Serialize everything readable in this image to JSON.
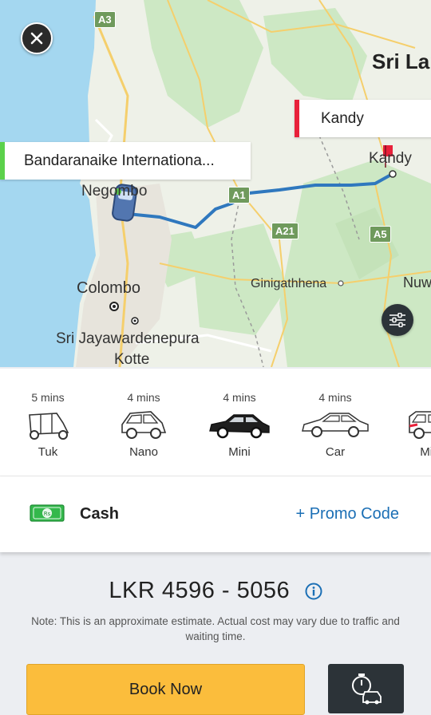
{
  "map": {
    "labels": {
      "negombo": "Negombo",
      "colombo": "Colombo",
      "sri_jaya": "Sri Jayawardenepura",
      "kotte": "Kotte",
      "kandy_city": "Kandy",
      "ginigathhena": "Ginigathhena",
      "sri_lanka": "Sri Lar",
      "nuw": "Nuw"
    },
    "shields": {
      "a3": "A3",
      "a1": "A1",
      "a21": "A21",
      "a5": "A5"
    },
    "pickup_label": "Bandaranaike Internationa...",
    "drop_label": "Kandy",
    "colors": {
      "pickup": "#5bd14b",
      "drop": "#e8213a",
      "route": "#2f78be",
      "water": "#a4d7f0",
      "land": "#eef1e8",
      "green": "#cde8c4"
    },
    "close_icon": "close-icon",
    "filter_icon": "sliders-icon"
  },
  "vehicles": [
    {
      "eta": "5 mins",
      "name": "Tuk",
      "icon": "tuk-tuk-icon"
    },
    {
      "eta": "4 mins",
      "name": "Nano",
      "icon": "nano-car-icon"
    },
    {
      "eta": "4 mins",
      "name": "Mini",
      "icon": "mini-car-icon",
      "selected": true
    },
    {
      "eta": "4 mins",
      "name": "Car",
      "icon": "sedan-car-icon"
    },
    {
      "eta": "",
      "name": "Mini",
      "icon": "minivan-icon"
    }
  ],
  "payment": {
    "method": "Cash",
    "promo": "+ Promo Code",
    "cash_icon": "cash-icon"
  },
  "fare": {
    "amount": "LKR 4596 - 5056",
    "note": "Note: This is an approximate estimate. Actual cost may vary due to traffic and waiting time.",
    "info_icon": "info-icon"
  },
  "actions": {
    "book_now": "Book Now",
    "schedule_icon": "schedule-ride-icon"
  }
}
